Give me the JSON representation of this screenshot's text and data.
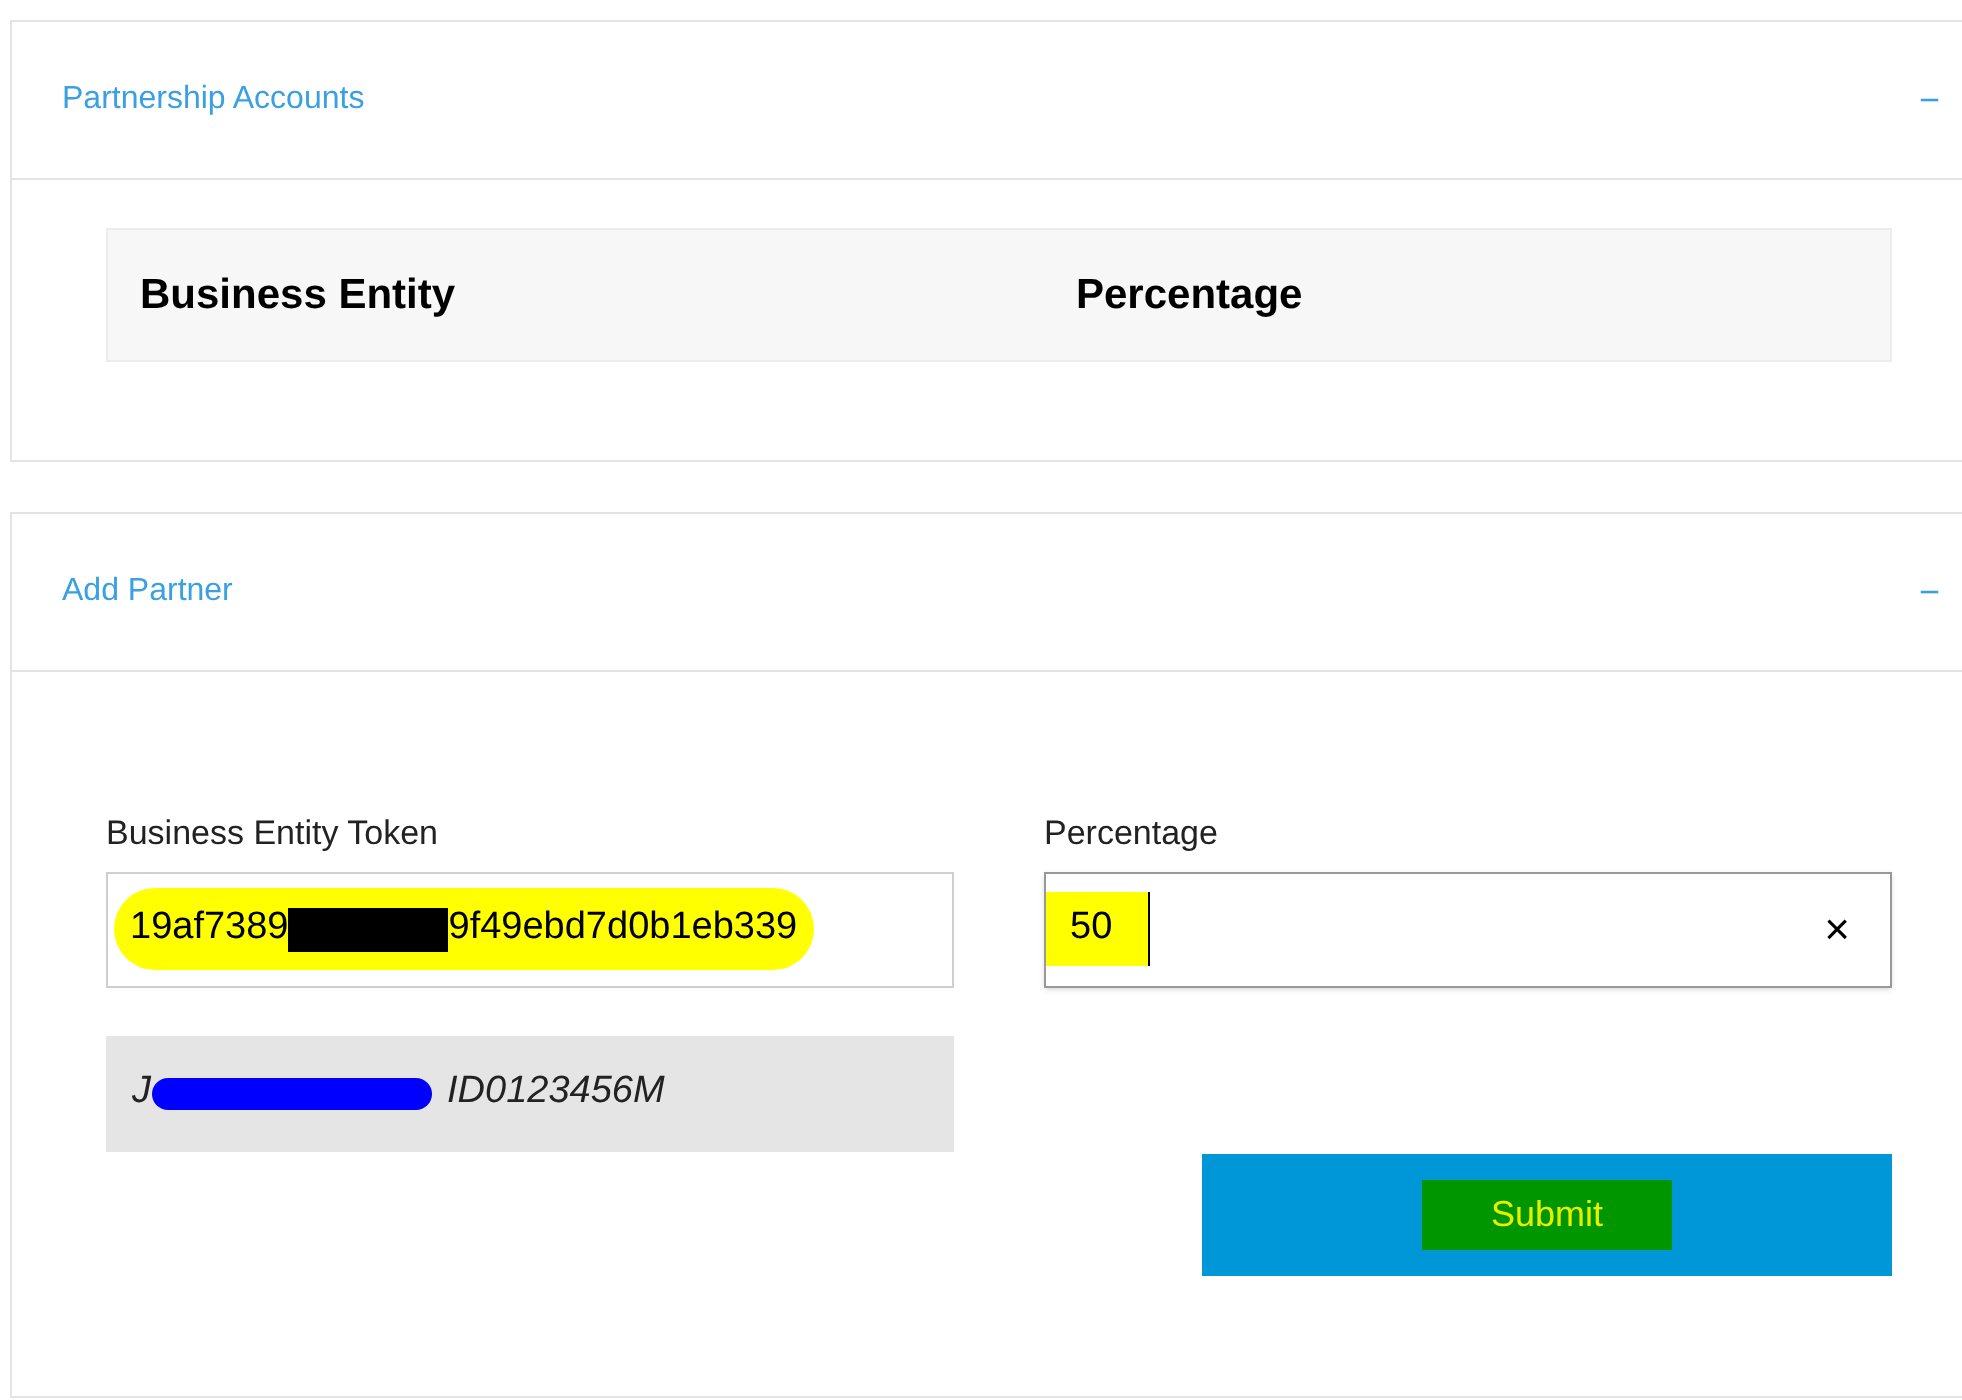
{
  "panels": [
    {
      "title": "Partnership Accounts",
      "collapse_symbol": "−",
      "expanded": true,
      "kind": "table",
      "columns": [
        "Business Entity",
        "Percentage"
      ]
    },
    {
      "title": "Add Partner",
      "collapse_symbol": "−",
      "expanded": true,
      "kind": "form",
      "token_field": {
        "label": "Business Entity Token",
        "value_start": "19af7389",
        "value_end": "9f49ebd7d0b1eb339"
      },
      "entity_result": {
        "name_start": "J",
        "id": "ID0123456M"
      },
      "percentage_field": {
        "label": "Percentage",
        "value": "50",
        "clear_symbol": "×"
      },
      "submit": "Submit"
    }
  ]
}
